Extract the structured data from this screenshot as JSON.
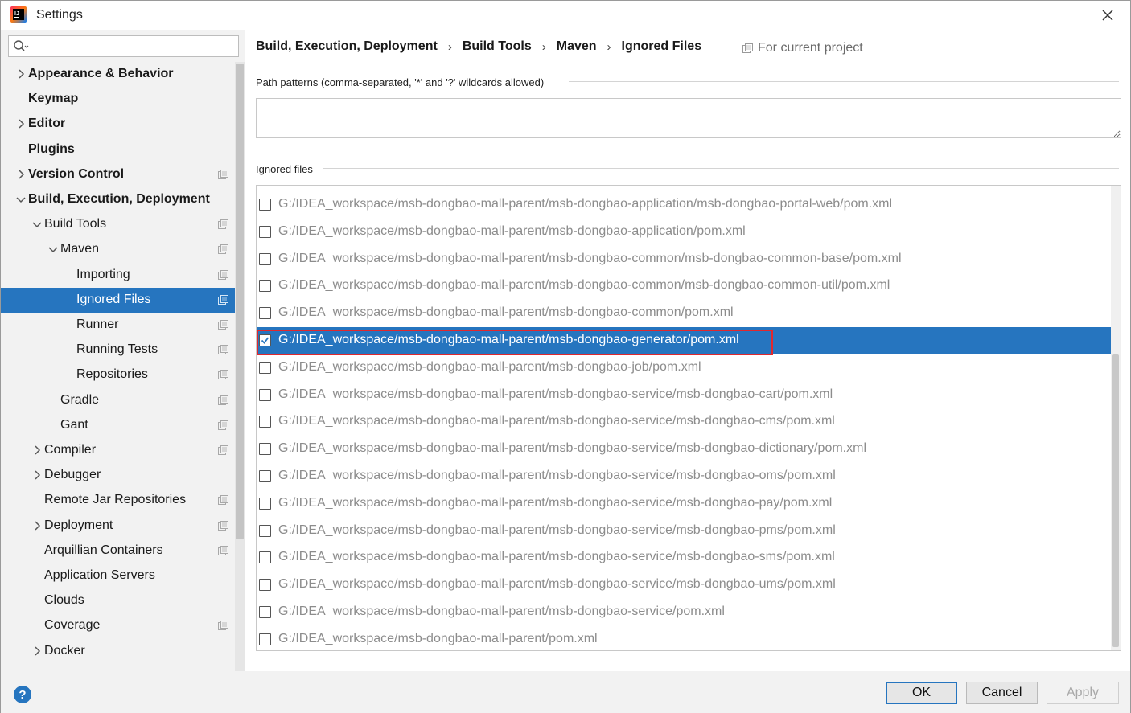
{
  "window": {
    "title": "Settings"
  },
  "search": {
    "placeholder": "",
    "value": ""
  },
  "sidebar": {
    "items": [
      {
        "label": "Appearance & Behavior",
        "bold": true,
        "level": 0,
        "chevron": "right",
        "project_icon": false
      },
      {
        "label": "Keymap",
        "bold": true,
        "level": 0,
        "chevron": "",
        "project_icon": false
      },
      {
        "label": "Editor",
        "bold": true,
        "level": 0,
        "chevron": "right",
        "project_icon": false
      },
      {
        "label": "Plugins",
        "bold": true,
        "level": 0,
        "chevron": "",
        "project_icon": false
      },
      {
        "label": "Version Control",
        "bold": true,
        "level": 0,
        "chevron": "right",
        "project_icon": true
      },
      {
        "label": "Build, Execution, Deployment",
        "bold": true,
        "level": 0,
        "chevron": "down",
        "project_icon": false
      },
      {
        "label": "Build Tools",
        "bold": false,
        "level": 1,
        "chevron": "down",
        "project_icon": true
      },
      {
        "label": "Maven",
        "bold": false,
        "level": 2,
        "chevron": "down",
        "project_icon": true
      },
      {
        "label": "Importing",
        "bold": false,
        "level": 3,
        "chevron": "",
        "project_icon": true
      },
      {
        "label": "Ignored Files",
        "bold": false,
        "level": 3,
        "chevron": "",
        "project_icon": true,
        "selected": true
      },
      {
        "label": "Runner",
        "bold": false,
        "level": 3,
        "chevron": "",
        "project_icon": true
      },
      {
        "label": "Running Tests",
        "bold": false,
        "level": 3,
        "chevron": "",
        "project_icon": true
      },
      {
        "label": "Repositories",
        "bold": false,
        "level": 3,
        "chevron": "",
        "project_icon": true
      },
      {
        "label": "Gradle",
        "bold": false,
        "level": 2,
        "chevron": "",
        "project_icon": true
      },
      {
        "label": "Gant",
        "bold": false,
        "level": 2,
        "chevron": "",
        "project_icon": true
      },
      {
        "label": "Compiler",
        "bold": false,
        "level": 1,
        "chevron": "right",
        "project_icon": true
      },
      {
        "label": "Debugger",
        "bold": false,
        "level": 1,
        "chevron": "right",
        "project_icon": false
      },
      {
        "label": "Remote Jar Repositories",
        "bold": false,
        "level": 1,
        "chevron": "",
        "project_icon": true
      },
      {
        "label": "Deployment",
        "bold": false,
        "level": 1,
        "chevron": "right",
        "project_icon": true
      },
      {
        "label": "Arquillian Containers",
        "bold": false,
        "level": 1,
        "chevron": "",
        "project_icon": true
      },
      {
        "label": "Application Servers",
        "bold": false,
        "level": 1,
        "chevron": "",
        "project_icon": false
      },
      {
        "label": "Clouds",
        "bold": false,
        "level": 1,
        "chevron": "",
        "project_icon": false
      },
      {
        "label": "Coverage",
        "bold": false,
        "level": 1,
        "chevron": "",
        "project_icon": true
      },
      {
        "label": "Docker",
        "bold": false,
        "level": 1,
        "chevron": "right",
        "project_icon": false
      }
    ]
  },
  "breadcrumb": [
    "Build, Execution, Deployment",
    "Build Tools",
    "Maven",
    "Ignored Files"
  ],
  "for_current_project": "For current project",
  "path_patterns": {
    "label": "Path patterns (comma-separated, '*' and '?' wildcards allowed)",
    "value": ""
  },
  "ignored_files": {
    "label": "Ignored files",
    "files": [
      {
        "path": "G:/IDEA_workspace/msb-dongbao-mall-parent/msb-dongbao-application/msb-dongbao-portal-web/pom.xml",
        "checked": false
      },
      {
        "path": "G:/IDEA_workspace/msb-dongbao-mall-parent/msb-dongbao-application/pom.xml",
        "checked": false
      },
      {
        "path": "G:/IDEA_workspace/msb-dongbao-mall-parent/msb-dongbao-common/msb-dongbao-common-base/pom.xml",
        "checked": false
      },
      {
        "path": "G:/IDEA_workspace/msb-dongbao-mall-parent/msb-dongbao-common/msb-dongbao-common-util/pom.xml",
        "checked": false
      },
      {
        "path": "G:/IDEA_workspace/msb-dongbao-mall-parent/msb-dongbao-common/pom.xml",
        "checked": false
      },
      {
        "path": "G:/IDEA_workspace/msb-dongbao-mall-parent/msb-dongbao-generator/pom.xml",
        "checked": true
      },
      {
        "path": "G:/IDEA_workspace/msb-dongbao-mall-parent/msb-dongbao-job/pom.xml",
        "checked": false
      },
      {
        "path": "G:/IDEA_workspace/msb-dongbao-mall-parent/msb-dongbao-service/msb-dongbao-cart/pom.xml",
        "checked": false
      },
      {
        "path": "G:/IDEA_workspace/msb-dongbao-mall-parent/msb-dongbao-service/msb-dongbao-cms/pom.xml",
        "checked": false
      },
      {
        "path": "G:/IDEA_workspace/msb-dongbao-mall-parent/msb-dongbao-service/msb-dongbao-dictionary/pom.xml",
        "checked": false
      },
      {
        "path": "G:/IDEA_workspace/msb-dongbao-mall-parent/msb-dongbao-service/msb-dongbao-oms/pom.xml",
        "checked": false
      },
      {
        "path": "G:/IDEA_workspace/msb-dongbao-mall-parent/msb-dongbao-service/msb-dongbao-pay/pom.xml",
        "checked": false
      },
      {
        "path": "G:/IDEA_workspace/msb-dongbao-mall-parent/msb-dongbao-service/msb-dongbao-pms/pom.xml",
        "checked": false
      },
      {
        "path": "G:/IDEA_workspace/msb-dongbao-mall-parent/msb-dongbao-service/msb-dongbao-sms/pom.xml",
        "checked": false
      },
      {
        "path": "G:/IDEA_workspace/msb-dongbao-mall-parent/msb-dongbao-service/msb-dongbao-ums/pom.xml",
        "checked": false
      },
      {
        "path": "G:/IDEA_workspace/msb-dongbao-mall-parent/msb-dongbao-service/pom.xml",
        "checked": false
      },
      {
        "path": "G:/IDEA_workspace/msb-dongbao-mall-parent/pom.xml",
        "checked": false
      }
    ]
  },
  "footer": {
    "help": "?",
    "ok": "OK",
    "cancel": "Cancel",
    "apply": "Apply",
    "apply_enabled": false
  },
  "colors": {
    "selection": "#2675bf",
    "highlight_border": "#e0282e",
    "muted_text": "#8c8c8c"
  },
  "icons": {
    "app": "intellij-logo-icon",
    "close": "close-icon",
    "search": "search-icon",
    "project_scope": "project-scope-icon",
    "checkbox": "checkmark-icon"
  }
}
